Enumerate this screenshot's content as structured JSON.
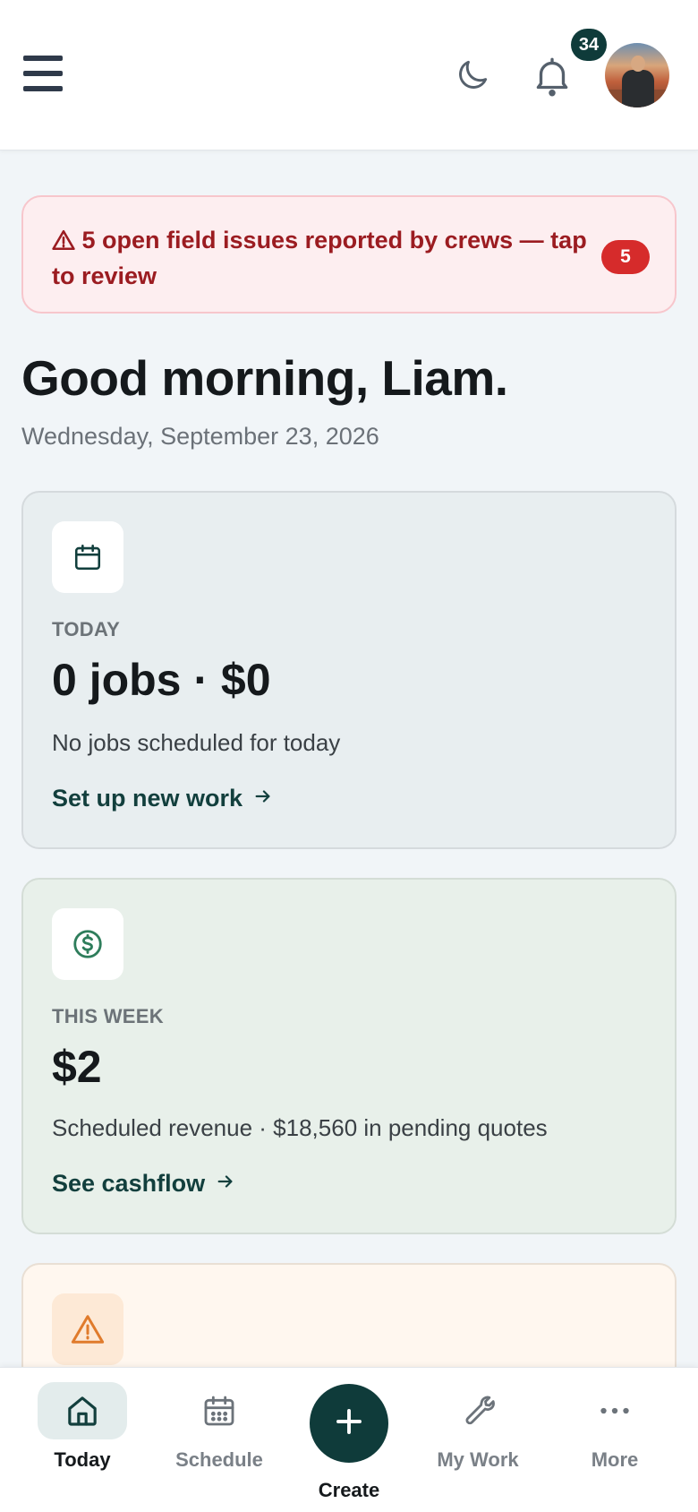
{
  "header": {
    "notification_count": "34",
    "icons": [
      "hamburger-menu-icon",
      "moon-icon",
      "bell-icon",
      "avatar"
    ]
  },
  "alert": {
    "text": "5 open field issues reported by crews — tap to review",
    "count": "5",
    "icon": "warning-icon"
  },
  "greeting": "Good morning, Liam.",
  "date": "Wednesday, September 23, 2026",
  "cards": {
    "today": {
      "label": "TODAY",
      "value": "0 jobs · $0",
      "description": "No jobs scheduled for today",
      "link": "Set up new work",
      "icon": "calendar-icon"
    },
    "week": {
      "label": "THIS WEEK",
      "value": "$2",
      "description": "Scheduled revenue · $18,560 in pending quotes",
      "link": "See cashflow",
      "icon": "dollar-circle-icon"
    },
    "warning": {
      "icon": "warning-triangle-icon"
    }
  },
  "nav": {
    "today": "Today",
    "schedule": "Schedule",
    "create": "Create",
    "my_work": "My Work",
    "more": "More"
  },
  "colors": {
    "brand": "#0f3b3a",
    "alert_text": "#9b1c21",
    "alert_bg": "#fdeef0",
    "alert_badge": "#d62b2b",
    "money_green": "#2e7d5b",
    "warning_orange": "#e07b2c"
  }
}
